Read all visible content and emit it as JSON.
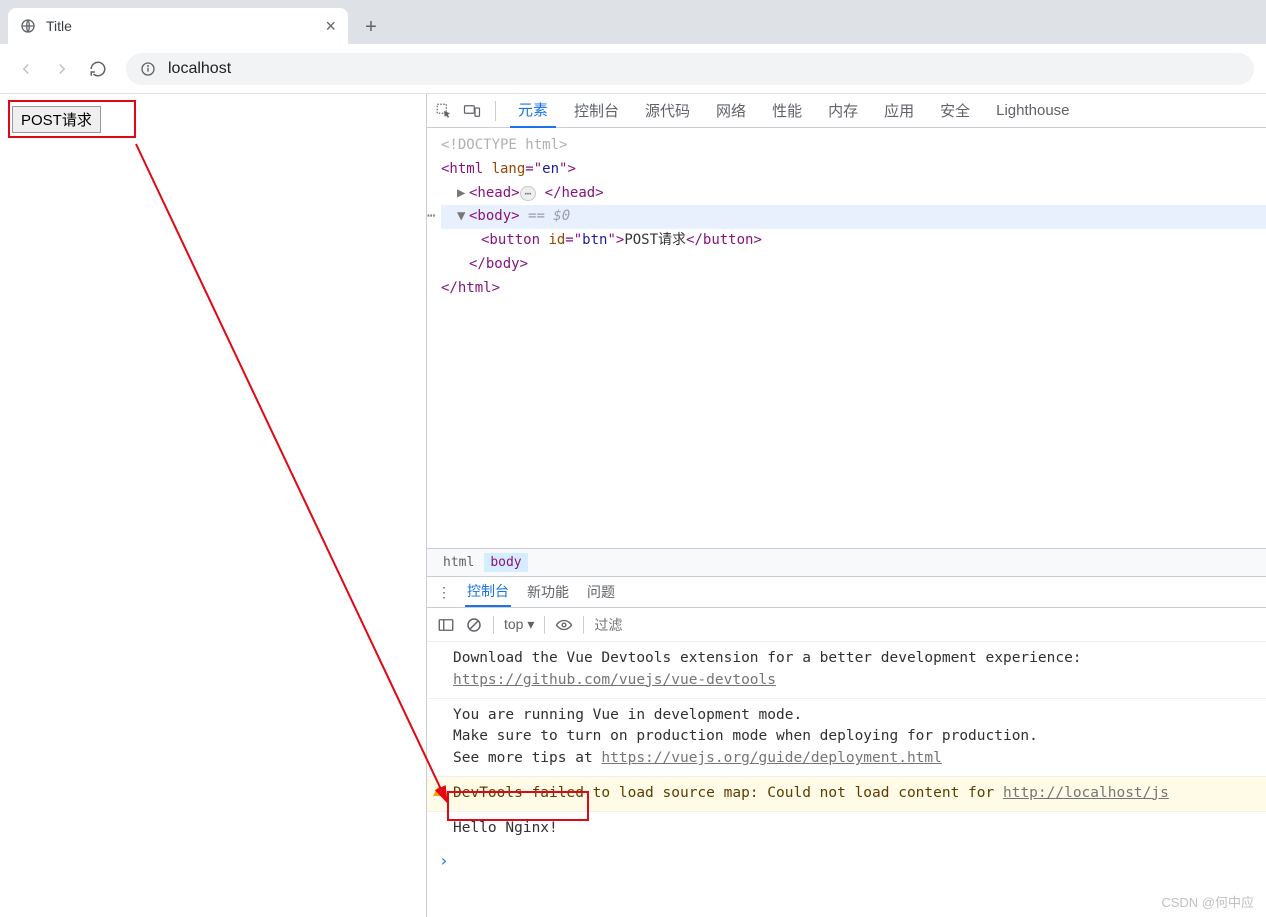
{
  "browser": {
    "tab_title": "Title",
    "new_tab": "+",
    "close_tab": "×",
    "url": "localhost"
  },
  "page": {
    "button_label": "POST请求"
  },
  "devtools": {
    "tabs": [
      "元素",
      "控制台",
      "源代码",
      "网络",
      "性能",
      "内存",
      "应用",
      "安全",
      "Lighthouse"
    ],
    "active_tab": "元素",
    "elements": {
      "doctype": "<!DOCTYPE html>",
      "html_open": "<html lang=\"en\">",
      "head": {
        "open": "<head>",
        "close": "</head>"
      },
      "body_open": "<body>",
      "body_marker": "== $0",
      "button_line": {
        "open": "<button id=\"btn\">",
        "text": "POST请求",
        "close": "</button>"
      },
      "body_close": "</body>",
      "html_close": "</html>"
    },
    "breadcrumb": [
      "html",
      "body"
    ],
    "console_tabs": [
      "控制台",
      "新功能",
      "问题"
    ],
    "console_active": "控制台",
    "console_filter_placeholder": "过滤",
    "console_top_label": "top",
    "console": [
      {
        "kind": "log",
        "lines": [
          "Download the Vue Devtools extension for a better development experience:"
        ],
        "link": "https://github.com/vuejs/vue-devtools"
      },
      {
        "kind": "log",
        "lines": [
          "You are running Vue in development mode.",
          "Make sure to turn on production mode when deploying for production."
        ],
        "link_prefix": "See more tips at ",
        "link": "https://vuejs.org/guide/deployment.html"
      },
      {
        "kind": "warn",
        "text": "DevTools failed to load source map: Could not load content for ",
        "link": "http://localhost/js"
      },
      {
        "kind": "output",
        "text": "Hello Nginx!"
      }
    ]
  },
  "watermark": "CSDN @何中应"
}
